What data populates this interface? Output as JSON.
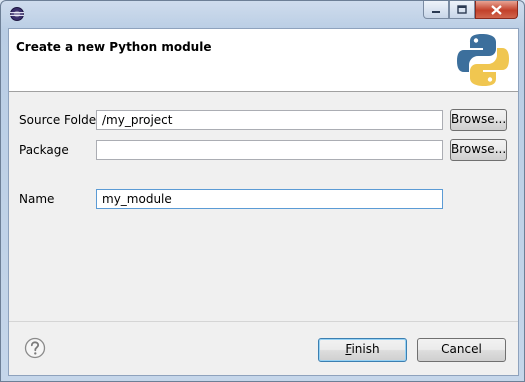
{
  "window": {
    "controls": [
      "minimize-icon",
      "maximize-icon",
      "close-icon"
    ]
  },
  "banner": {
    "title": "Create a new Python module",
    "logo": "python-logo-icon"
  },
  "form": {
    "source_folder_label": "Source Folder",
    "source_folder_value": "/my_project",
    "package_label": "Package",
    "package_value": "",
    "name_label": "Name",
    "name_value": "my_module",
    "browse_label": "Browse..."
  },
  "footer": {
    "help_icon": "help-icon",
    "finish_mnemonic": "F",
    "finish_rest": "inish",
    "cancel_label": "Cancel"
  },
  "colors": {
    "python_blue": "#3c6f9c",
    "python_yellow": "#f0c650",
    "close_red": "#c2402a"
  }
}
